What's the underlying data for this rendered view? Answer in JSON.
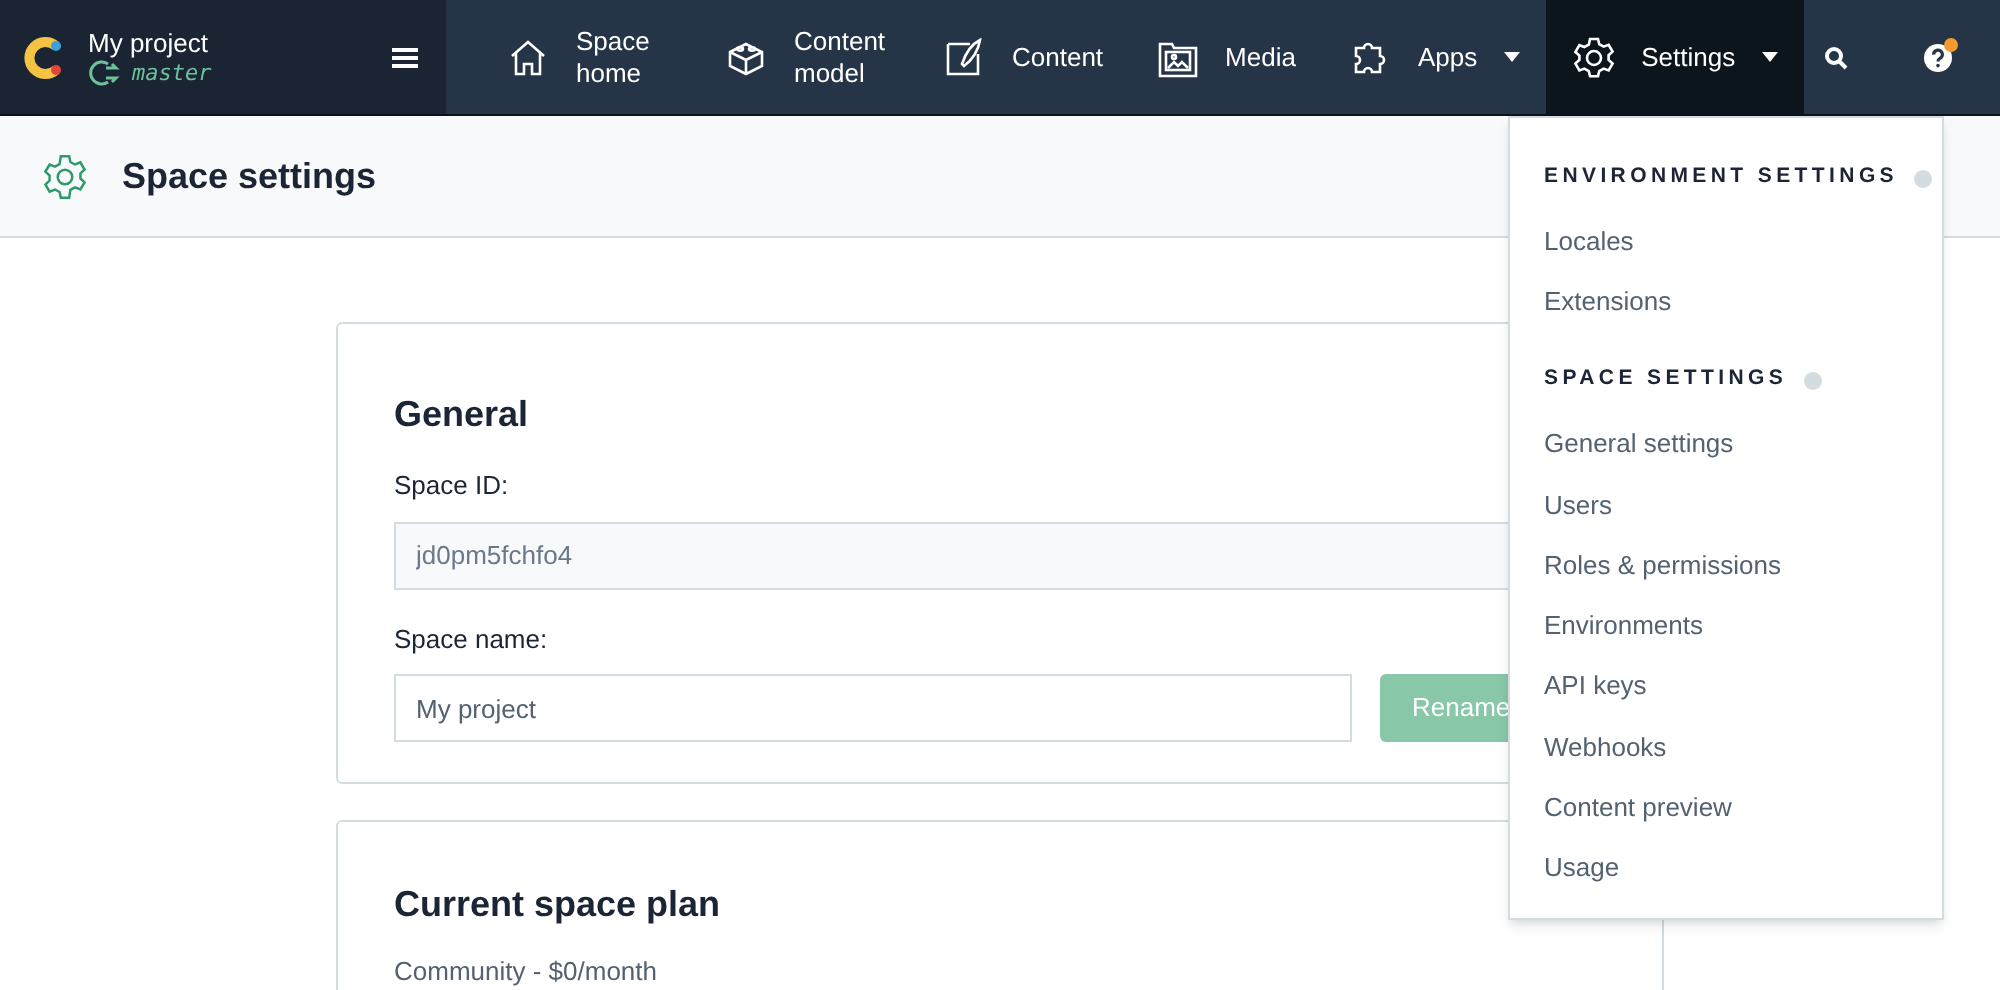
{
  "project": {
    "name": "My project",
    "environment": "master"
  },
  "nav": [
    {
      "kind": "home",
      "label": "Space home",
      "selected": false,
      "dropdown": false
    },
    {
      "kind": "model",
      "label": "Content model",
      "selected": false,
      "dropdown": false
    },
    {
      "kind": "content",
      "label": "Content",
      "selected": false,
      "dropdown": false
    },
    {
      "kind": "media",
      "label": "Media",
      "selected": false,
      "dropdown": false
    },
    {
      "kind": "apps",
      "label": "Apps",
      "selected": false,
      "dropdown": true
    },
    {
      "kind": "settings",
      "label": "Settings",
      "selected": true,
      "dropdown": true
    }
  ],
  "help": {
    "notification": true
  },
  "page_header": {
    "title": "Space settings"
  },
  "general": {
    "title": "General",
    "space_id_label": "Space ID:",
    "space_id": "jd0pm5fchfo4",
    "space_name_label": "Space name:",
    "space_name": "My project",
    "rename_button": "Rename"
  },
  "plan": {
    "title": "Current space plan",
    "description": "Community - $0/month"
  },
  "settings_menu": {
    "sections": [
      {
        "heading": "ENVIRONMENT SETTINGS",
        "items": [
          "Locales",
          "Extensions"
        ]
      },
      {
        "heading": "SPACE SETTINGS",
        "items": [
          "General settings",
          "Users",
          "Roles & permissions",
          "Environments",
          "API keys",
          "Webhooks",
          "Content preview",
          "Usage"
        ]
      }
    ]
  }
}
